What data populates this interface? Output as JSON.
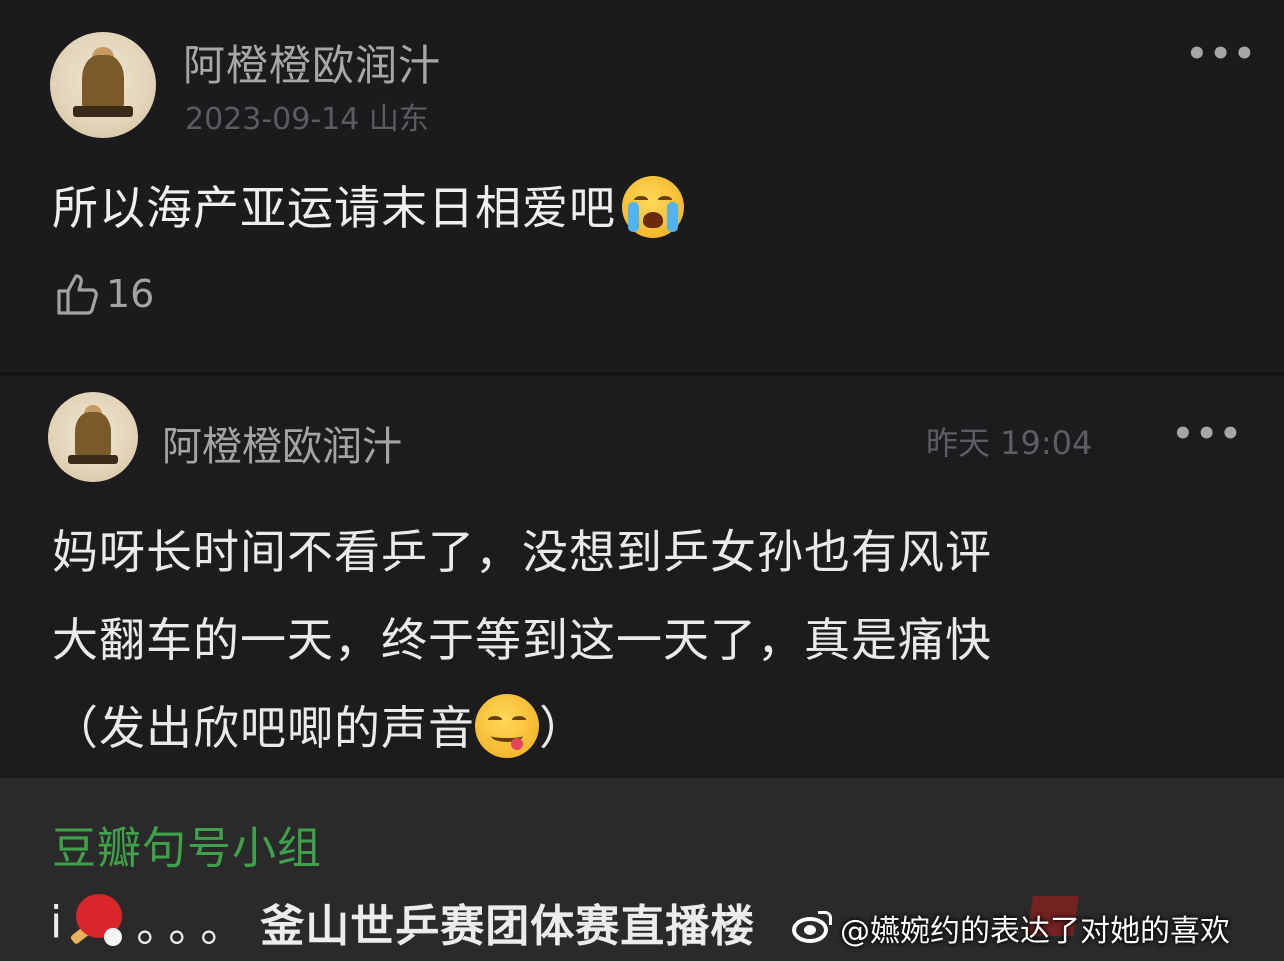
{
  "post1": {
    "author": "阿橙橙欧润汁",
    "date_location": "2023-09-14 山东",
    "content": "所以海产亚运请末日相爱吧",
    "emoji": "loudly-crying-face-emoji",
    "like_count": "16",
    "more": "•••"
  },
  "post2": {
    "author": "阿橙橙欧润汁",
    "time": "昨天 19:04",
    "more": "•••",
    "content_lines": [
      "妈呀长时间不看乒了，没想到乒女孙也有风评",
      "大翻车的一天，终于等到这一天了，真是痛快",
      "（发出欣吧唧的声音"
    ],
    "content_tail": "）",
    "emoji": "face-savoring-food-emoji"
  },
  "group": {
    "name": "豆瓣句号小组",
    "post_prefix": "i",
    "post_dots": "。。。",
    "post_title": "釜山世乒赛团体赛直播楼"
  },
  "watermark": {
    "text": "@嬿婉约的表达了对她的喜欢",
    "logo": "weibo-logo"
  },
  "colors": {
    "background": "#1b1b1d",
    "group_green": "#3fa14a",
    "group_background": "#2a2a2b"
  }
}
